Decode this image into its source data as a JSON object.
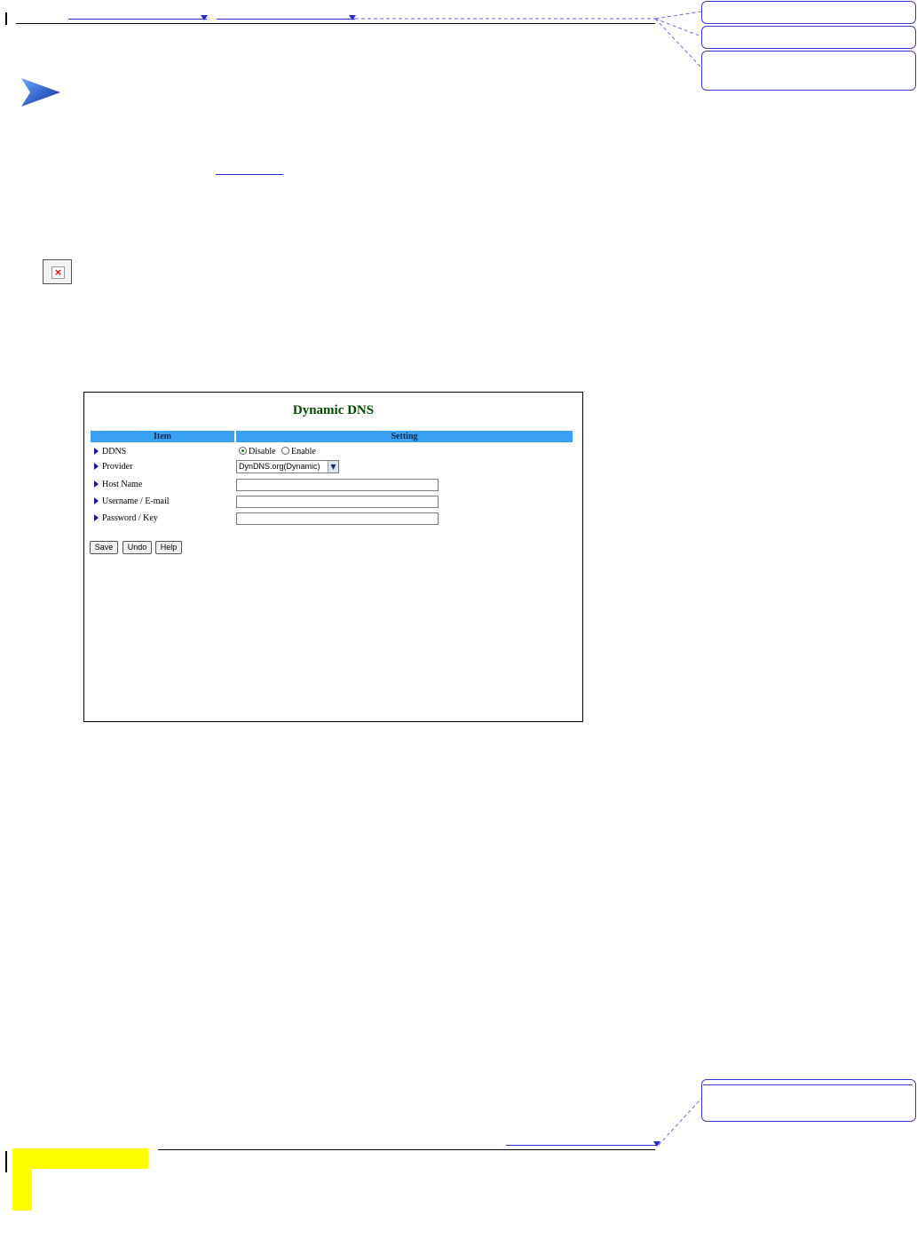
{
  "panel": {
    "title": "Dynamic DNS",
    "table_headers": [
      "Item",
      "Setting"
    ],
    "rows": [
      {
        "label": "DDNS"
      },
      {
        "label": "Provider"
      },
      {
        "label": "Host Name",
        "value": ""
      },
      {
        "label": "Username / E-mail",
        "value": ""
      },
      {
        "label": "Password / Key",
        "value": ""
      }
    ],
    "ddns_options": [
      "Disable",
      "Enable"
    ],
    "ddns_selected": "Disable",
    "provider_selected": "DynDNS.org(Dynamic)",
    "buttons": {
      "save": "Save",
      "undo": "Undo",
      "help": "Help"
    }
  },
  "colors": {
    "header_blue": "#3aa0f2",
    "title_green": "#004a00",
    "link_blue": "#2b2bd6",
    "highlight_yellow": "#ffff00"
  },
  "icons": {
    "bullet": "blue-arrow-icon",
    "broken_image": "broken-image-icon",
    "row_marker": "triangle-right-icon",
    "select_drop": "chevron-down-icon"
  }
}
